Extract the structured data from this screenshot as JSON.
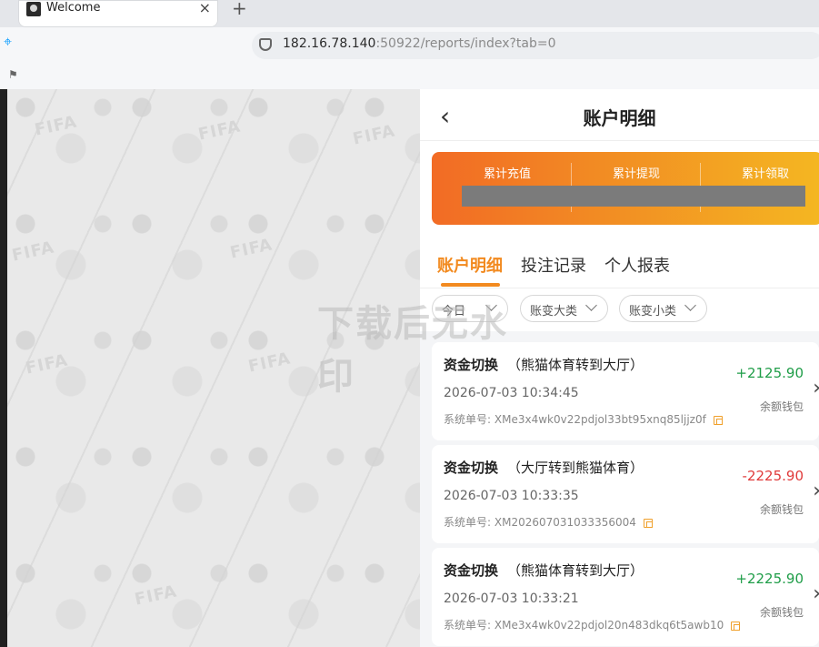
{
  "browser": {
    "tab_title": "Welcome",
    "tab_close": "×",
    "new_tab": "+",
    "url_host": "182.16.78.140",
    "url_rest": ":50922/reports/index?tab=0",
    "icons": [
      "favicon-icon",
      "close-icon",
      "plus-icon",
      "shield-icon",
      "flag-icon"
    ]
  },
  "background": {
    "pattern_texts": [
      "FIFA",
      "FIFA",
      "FIFA",
      "FIFA",
      "FIFA",
      "FIFA",
      "FIFA",
      "FIFA"
    ]
  },
  "page": {
    "back_icon": "chevron-left-icon",
    "title": "账户明细",
    "summary_labels": [
      "累计充值",
      "累计提现",
      "累计领取"
    ],
    "tabs": [
      "账户明细",
      "投注记录",
      "个人报表"
    ],
    "filters": [
      "今日",
      "账变大类",
      "账变小类"
    ],
    "watermark": "下载后无水印",
    "accent_color": "#f28a1f",
    "records": [
      {
        "title": "资金切换",
        "note": "（熊猫体育转到大厅）",
        "time": "2026-07-03 10:34:45",
        "order_label": "系统单号:",
        "order_id": "XMe3x4wk0v22pdjol33bt95xnq85ljjz0f",
        "amount": "+2125.90",
        "wallet": "余额钱包"
      },
      {
        "title": "资金切换",
        "note": "（大厅转到熊猫体育）",
        "time": "2026-07-03 10:33:35",
        "order_label": "系统单号:",
        "order_id": "XM20260703103335​6004",
        "amount": "-2225.90",
        "wallet": "余额钱包"
      },
      {
        "title": "资金切换",
        "note": "（熊猫体育转到大厅）",
        "time": "2026-07-03 10:33:21",
        "order_label": "系统单号:",
        "order_id": "XMe3x4wk0v22pdjol20n483dkq6t5awb10",
        "amount": "+2225.90",
        "wallet": "余额钱包"
      }
    ]
  }
}
